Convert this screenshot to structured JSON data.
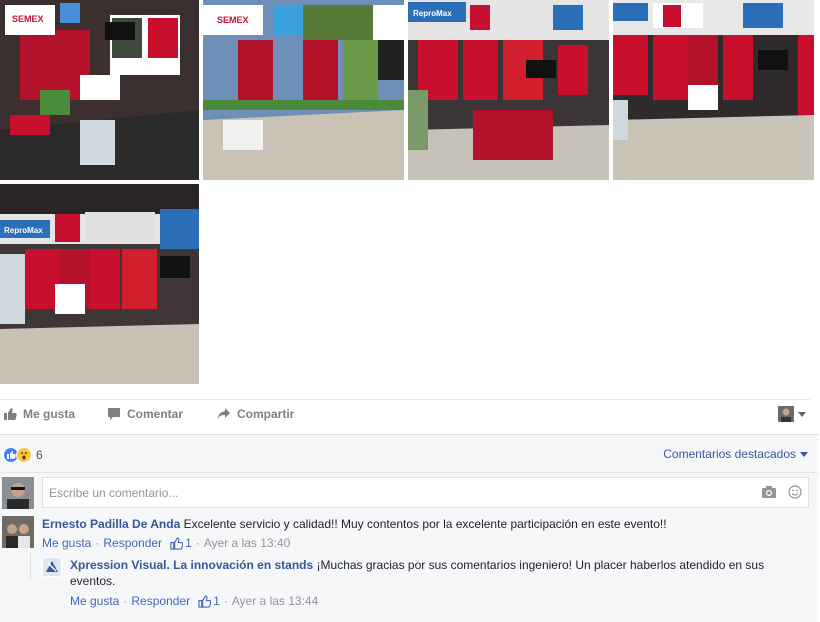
{
  "actions": {
    "like": "Me gusta",
    "comment": "Comentar",
    "share": "Compartir"
  },
  "reactions": {
    "count": "6"
  },
  "sort": {
    "label": "Comentarios destacados"
  },
  "composer": {
    "placeholder": "Escribe un comentario..."
  },
  "comments": [
    {
      "author": "Ernesto Padilla De Anda",
      "text": "Excelente servicio y calidad!! Muy contentos por la excelente participación en este evento!!",
      "like_label": "Me gusta",
      "reply_label": "Responder",
      "likes": "1",
      "time": "Ayer a las 13:40"
    },
    {
      "author": "Xpression Visual. La innovación en stands",
      "text": "¡Muchas gracias por sus comentarios ingeniero! Un placer haberlos atendido en sus eventos.",
      "like_label": "Me gusta",
      "reply_label": "Responder",
      "likes": "1",
      "time": "Ayer a las 13:44"
    }
  ],
  "photos": {
    "brand_1": "SEMEX",
    "brand_2": "ReproMax"
  },
  "colors": {
    "link": "#365899",
    "booth_red": "#c8102e",
    "like_blue": "#4080ff"
  }
}
